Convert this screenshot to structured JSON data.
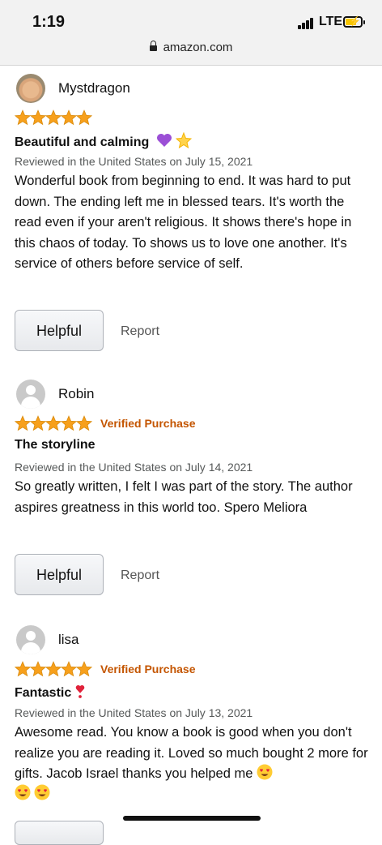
{
  "status": {
    "time": "1:19",
    "network": "LTE"
  },
  "browser": {
    "url": "amazon.com"
  },
  "colors": {
    "star": "#f7a01c",
    "verified": "#c45500",
    "link": "#565959"
  },
  "reviews": [
    {
      "username": "Mystdragon",
      "rating": 5,
      "verified": "",
      "title": "Beautiful and calming",
      "title_emoji": [
        "purple-heart",
        "glowing-star"
      ],
      "meta": "Reviewed in the United States on July 15, 2021",
      "body": "Wonderful book from beginning to end. It was hard to put down. The ending left me in blessed tears. It's worth the read even if your aren't religious. It shows there's hope in this chaos of today. To shows us to love one another. It's service of others before service of self.",
      "helpful": "Helpful",
      "report": "Report"
    },
    {
      "username": "Robin",
      "rating": 5,
      "verified": "Verified Purchase",
      "title": "The storyline",
      "meta": "Reviewed in the United States on July 14, 2021",
      "body": "So greatly written, I felt I was part of the story. The author aspires greatness in this world too. Spero Meliora",
      "helpful": "Helpful",
      "report": "Report"
    },
    {
      "username": "lisa",
      "rating": 5,
      "verified": "Verified Purchase",
      "title": "Fantastic",
      "title_emoji": [
        "heart-exclamation"
      ],
      "meta": "Reviewed in the United States on July 13, 2021",
      "body": "Awesome read. You know a book is good when you don't realize you are reading it. Loved so much bought 2 more for gifts. Jacob Israel thanks you helped me",
      "body_emoji": [
        "heart-eyes-face",
        "heart-eyes-face",
        "heart-eyes-face"
      ]
    }
  ]
}
